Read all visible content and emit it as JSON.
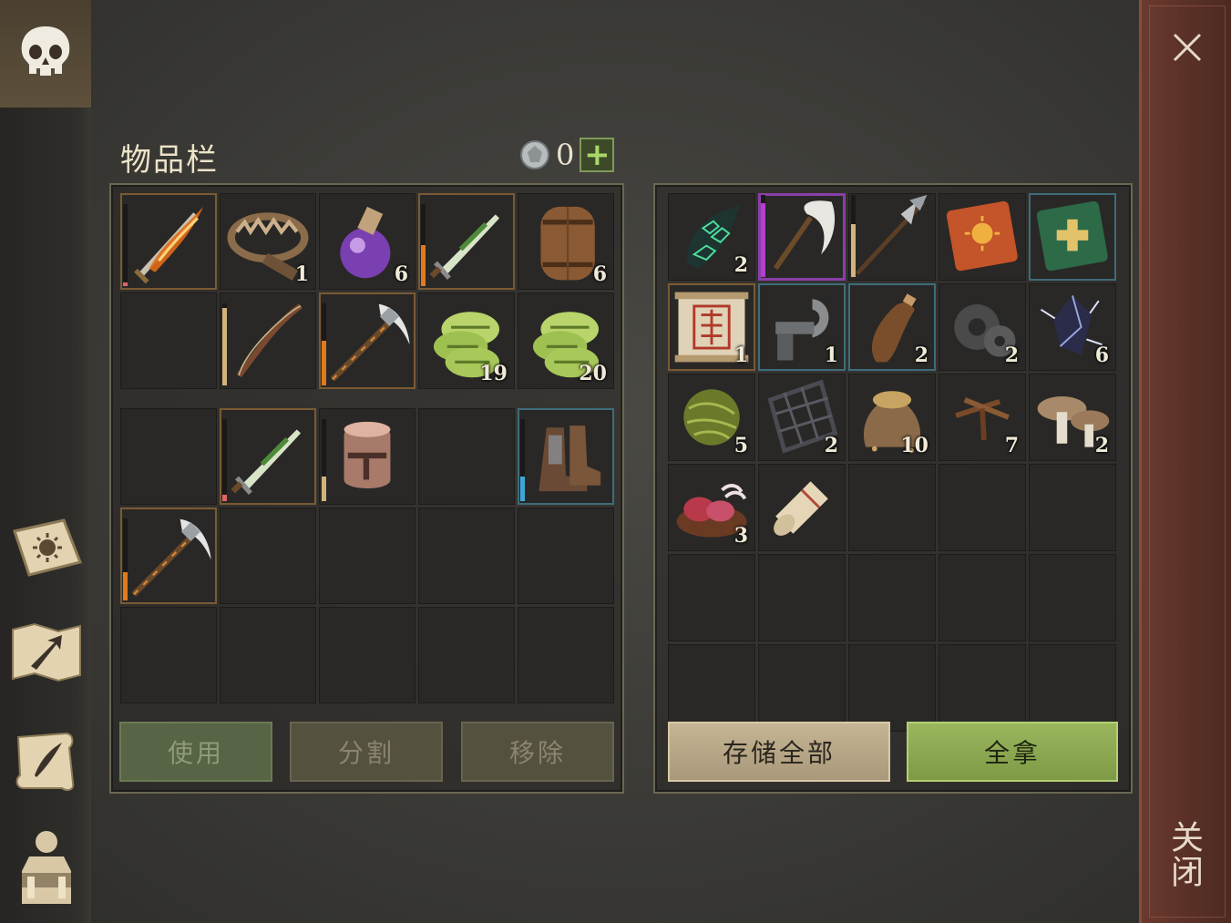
{
  "window": {
    "close_label": "关闭"
  },
  "nav": [
    "skull-icon",
    "sun-book-icon",
    "map-arrow-icon",
    "scroll-quill-icon",
    "backpack-character-icon"
  ],
  "inventory": {
    "title": "物品栏",
    "coins": "0",
    "plus_label": "+",
    "rows": [
      [
        {
          "icon": "flaming-sword-icon",
          "count": "",
          "frame": "orange",
          "dur": 0.05,
          "dur_color": "#d66"
        },
        {
          "icon": "bear-trap-icon",
          "count": "1"
        },
        {
          "icon": "purple-potion-icon",
          "count": "6"
        },
        {
          "icon": "green-dagger-icon",
          "count": "",
          "frame": "orange",
          "dur": 0.5,
          "dur_color": "#e07a1f"
        },
        {
          "icon": "barrel-icon",
          "count": "6"
        }
      ],
      [
        {
          "icon": "",
          "count": ""
        },
        {
          "icon": "bow-icon",
          "count": "",
          "dur": 0.95,
          "dur_color": "#d3b27c"
        },
        {
          "icon": "pickaxe-icon",
          "count": "",
          "frame": "orange",
          "dur": 0.55,
          "dur_color": "#e07a1f"
        },
        {
          "icon": "green-fiber-icon",
          "count": "19"
        },
        {
          "icon": "green-fiber-icon",
          "count": "20"
        }
      ]
    ],
    "rows2": [
      [
        {
          "icon": "",
          "count": ""
        },
        {
          "icon": "green-dagger-icon",
          "count": "",
          "frame": "orange",
          "dur": 0.08,
          "dur_color": "#d66"
        },
        {
          "icon": "knight-helmet-icon",
          "count": "",
          "dur": 0.3,
          "dur_color": "#d3b27c"
        },
        {
          "icon": "",
          "count": ""
        },
        {
          "icon": "boots-icon",
          "count": "",
          "frame": "blue",
          "dur": 0.3,
          "dur_color": "#3fa6d8"
        }
      ],
      [
        {
          "icon": "pickaxe-icon",
          "count": "",
          "frame": "orange",
          "dur": 0.35,
          "dur_color": "#e07a1f"
        },
        {
          "icon": "",
          "count": ""
        },
        {
          "icon": "",
          "count": ""
        },
        {
          "icon": "",
          "count": ""
        },
        {
          "icon": "",
          "count": ""
        }
      ],
      [
        {
          "icon": "",
          "count": ""
        },
        {
          "icon": "",
          "count": ""
        },
        {
          "icon": "",
          "count": ""
        },
        {
          "icon": "",
          "count": ""
        },
        {
          "icon": "",
          "count": ""
        }
      ]
    ],
    "buttons": {
      "use": "使用",
      "split": "分割",
      "remove": "移除"
    }
  },
  "storage": {
    "rows": [
      [
        {
          "icon": "green-crystal-shard-icon",
          "count": "2"
        },
        {
          "icon": "scythe-icon",
          "count": "",
          "frame": "purple",
          "dur": 0.9,
          "dur_color": "#b33fd0"
        },
        {
          "icon": "halberd-icon",
          "count": "",
          "dur": 0.65,
          "dur_color": "#d3b27c"
        },
        {
          "icon": "sun-tome-icon",
          "count": ""
        },
        {
          "icon": "green-cross-tome-icon",
          "count": "",
          "frame": "blue"
        }
      ],
      [
        {
          "icon": "rune-scroll-icon",
          "count": "1",
          "frame": "orange"
        },
        {
          "icon": "iron-hook-icon",
          "count": "1",
          "frame": "blue"
        },
        {
          "icon": "leather-flask-icon",
          "count": "2",
          "frame": "blue"
        },
        {
          "icon": "gears-icon",
          "count": "2"
        },
        {
          "icon": "dark-crystal-icon",
          "count": "6"
        }
      ],
      [
        {
          "icon": "grass-ball-icon",
          "count": "5"
        },
        {
          "icon": "wooden-lattice-icon",
          "count": "2"
        },
        {
          "icon": "grain-sack-icon",
          "count": "10"
        },
        {
          "icon": "nails-icon",
          "count": "7"
        },
        {
          "icon": "mushrooms-icon",
          "count": "2"
        }
      ],
      [
        {
          "icon": "raw-meat-bowl-icon",
          "count": "3"
        },
        {
          "icon": "parchment-roll-icon",
          "count": ""
        },
        {
          "icon": "",
          "count": ""
        },
        {
          "icon": "",
          "count": ""
        },
        {
          "icon": "",
          "count": ""
        }
      ],
      [
        {
          "icon": "",
          "count": ""
        },
        {
          "icon": "",
          "count": ""
        },
        {
          "icon": "",
          "count": ""
        },
        {
          "icon": "",
          "count": ""
        },
        {
          "icon": "",
          "count": ""
        }
      ],
      [
        {
          "icon": "",
          "count": ""
        },
        {
          "icon": "",
          "count": ""
        },
        {
          "icon": "",
          "count": ""
        },
        {
          "icon": "",
          "count": ""
        },
        {
          "icon": "",
          "count": ""
        }
      ]
    ],
    "buttons": {
      "store_all": "存储全部",
      "take_all": "全拿"
    }
  }
}
